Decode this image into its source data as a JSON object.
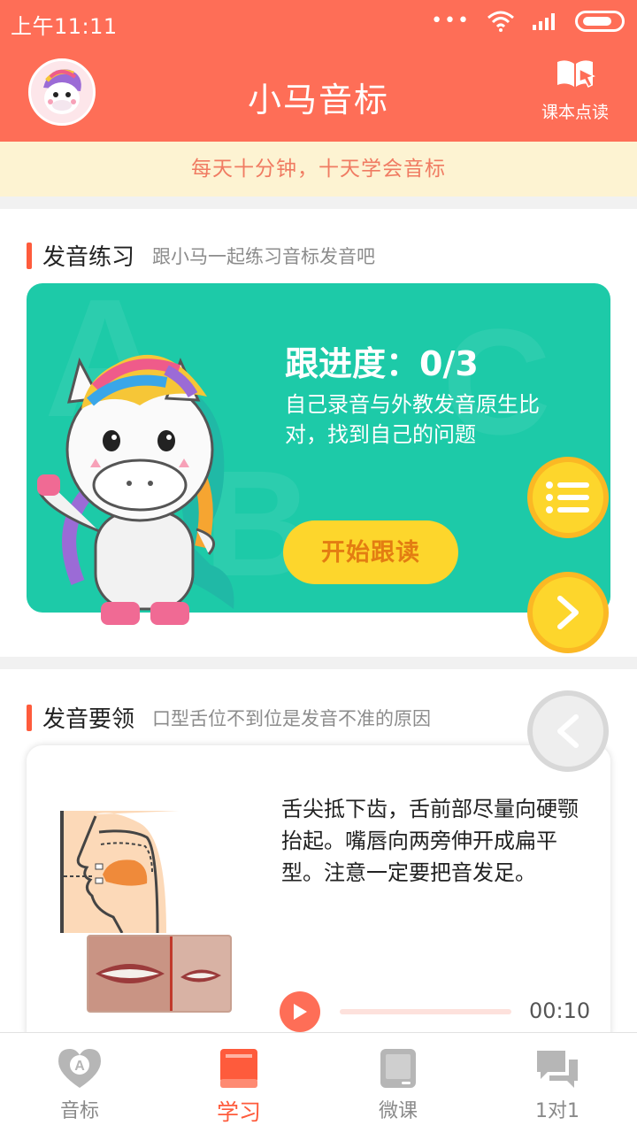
{
  "status_bar": {
    "time": "上午11:11"
  },
  "header": {
    "title": "小马音标",
    "textbook_read_label": "课本点读"
  },
  "banner": {
    "text": "每天十分钟，十天学会音标"
  },
  "practice_section": {
    "title": "发音练习",
    "subtitle": "跟小马一起练习音标发音吧",
    "progress_label": "跟进度：0/3",
    "description": "自己录音与外教发音原生比对，找到自己的问题",
    "start_button": "开始跟读"
  },
  "guide_section": {
    "title": "发音要领",
    "subtitle": "口型舌位不到位是发音不准的原因",
    "instruction": "舌尖抵下齿，舌前部尽量向硬颚抬起。嘴唇向两旁伸开成扁平型。注意一定要把音发足。",
    "audio": {
      "time": "00:10",
      "progress": 0
    }
  },
  "tabs": [
    {
      "label": "音标",
      "active": false,
      "icon": "phonetic-heart-icon"
    },
    {
      "label": "学习",
      "active": true,
      "icon": "book-icon"
    },
    {
      "label": "微课",
      "active": false,
      "icon": "tablet-icon"
    },
    {
      "label": "1对1",
      "active": false,
      "icon": "chat-icon"
    }
  ],
  "colors": {
    "brand": "#fe6e57",
    "accent": "#fe5b3c",
    "card_green": "#1dcaa8",
    "button_yellow": "#fdd62c",
    "banner_bg": "#fdf3d2"
  }
}
